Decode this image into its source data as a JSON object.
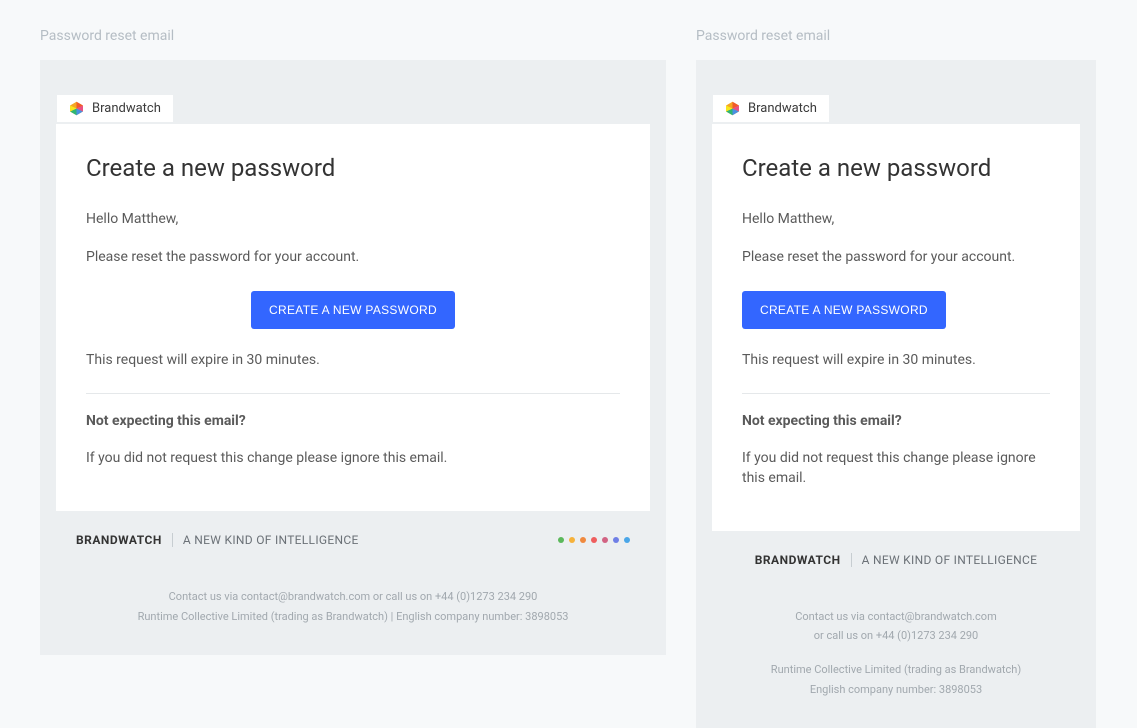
{
  "section_label": "Password reset email",
  "logo": {
    "text": "Brandwatch"
  },
  "email": {
    "heading": "Create a new password",
    "greeting": "Hello Matthew,",
    "instruction": "Please reset the password for your account.",
    "cta": "CREATE A NEW PASSWORD",
    "expiry": "This request will expire in 30 minutes.",
    "notexpect_head": "Not expecting this email?",
    "notexpect_body": "If you did not request this change please ignore this email."
  },
  "brand": {
    "name": "BRANDWATCH",
    "tagline": "A NEW KIND OF INTELLIGENCE"
  },
  "footer": {
    "left": {
      "contact": "Contact us via contact@brandwatch.com or call us on +44 (0)1273 234 290",
      "company": "Runtime Collective Limited (trading as Brandwatch) | English company number: 3898053"
    },
    "right": {
      "contact_l1": "Contact us via contact@brandwatch.com",
      "contact_l2": "or call us on +44 (0)1273 234 290",
      "company_l1": "Runtime Collective Limited (trading as Brandwatch)",
      "company_l2": "English company number: 3898053"
    }
  }
}
